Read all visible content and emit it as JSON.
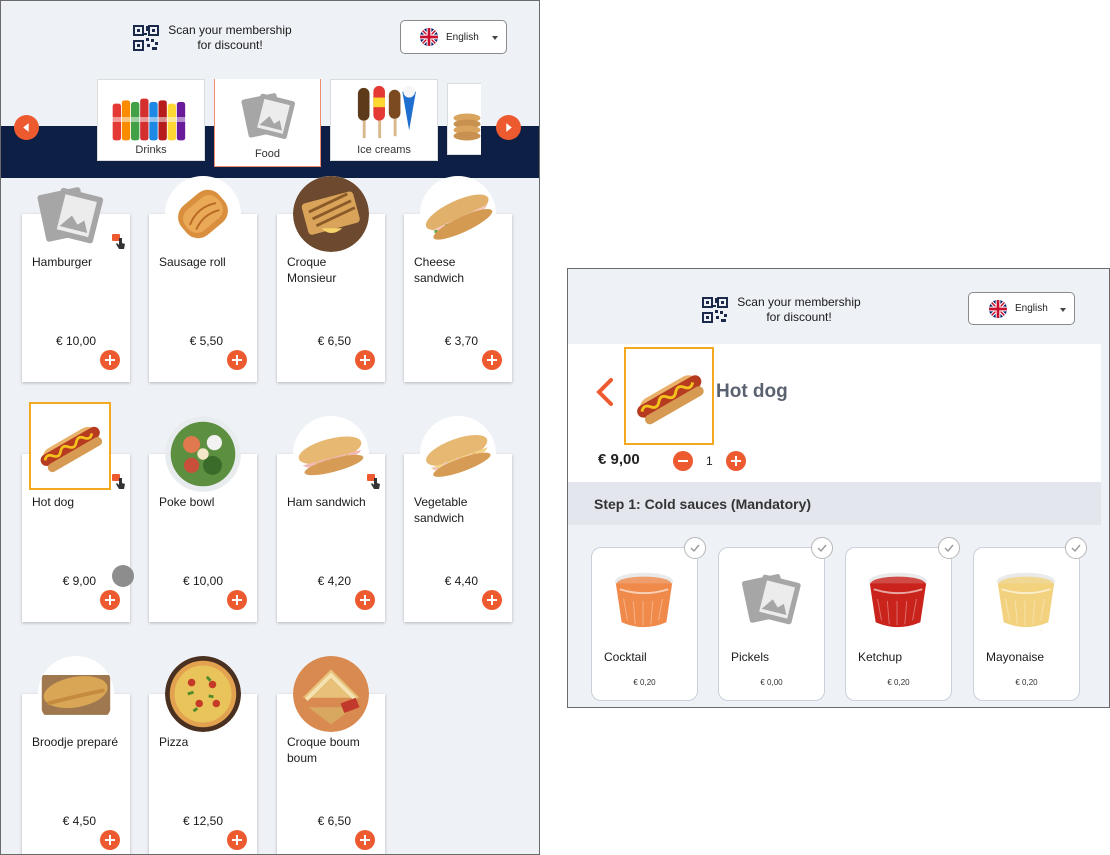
{
  "header": {
    "membership_line1": "Scan your membership",
    "membership_line2": "for discount!",
    "language": "English"
  },
  "categories": [
    {
      "label": "Drinks",
      "icon": "drinks-bottles-image"
    },
    {
      "label": "Food",
      "icon": "placeholder-image-icon",
      "selected": true
    },
    {
      "label": "Ice creams",
      "icon": "ice-cream-image"
    },
    {
      "label": "",
      "icon": "pancakes-image"
    }
  ],
  "products": [
    {
      "name": "Hamburger",
      "price": "€ 10,00",
      "icon": "placeholder-image-icon"
    },
    {
      "name": "Sausage roll",
      "price": "€ 5,50",
      "icon": "sausage-roll-image"
    },
    {
      "name": "Croque Monsieur",
      "price": "€ 6,50",
      "icon": "croque-monsieur-image"
    },
    {
      "name": "Cheese sandwich",
      "price": "€ 3,70",
      "icon": "cheese-sandwich-image"
    },
    {
      "name": "Hot dog",
      "price": "€ 9,00",
      "icon": "hot-dog-image",
      "selected": true
    },
    {
      "name": "Poke bowl",
      "price": "€ 10,00",
      "icon": "poke-bowl-image"
    },
    {
      "name": "Ham sandwich",
      "price": "€ 4,20",
      "icon": "ham-sandwich-image"
    },
    {
      "name": "Vegetable sandwich",
      "price": "€ 4,40",
      "icon": "vegetable-sandwich-image"
    },
    {
      "name": "Broodje preparé",
      "price": "€ 4,50",
      "icon": "broodje-image"
    },
    {
      "name": "Pizza",
      "price": "€ 12,50",
      "icon": "pizza-image"
    },
    {
      "name": "Croque boum boum",
      "price": "€ 6,50",
      "icon": "croque-boum-image"
    }
  ],
  "detail": {
    "title": "Hot dog",
    "price": "€ 9,00",
    "quantity": "1",
    "step_title": "Step 1: Cold sauces (Mandatory)",
    "sauces": [
      {
        "name": "Cocktail",
        "price": "€ 0,20",
        "icon": "cocktail-sauce-image"
      },
      {
        "name": "Pickels",
        "price": "€ 0,00",
        "icon": "placeholder-image-icon"
      },
      {
        "name": "Ketchup",
        "price": "€ 0,20",
        "icon": "ketchup-image"
      },
      {
        "name": "Mayonaise",
        "price": "€ 0,20",
        "icon": "mayonnaise-image"
      }
    ]
  },
  "colors": {
    "accent": "#ee5a2f",
    "navy": "#0d1f44",
    "selection": "#f2a920",
    "background": "#eef1f6"
  }
}
